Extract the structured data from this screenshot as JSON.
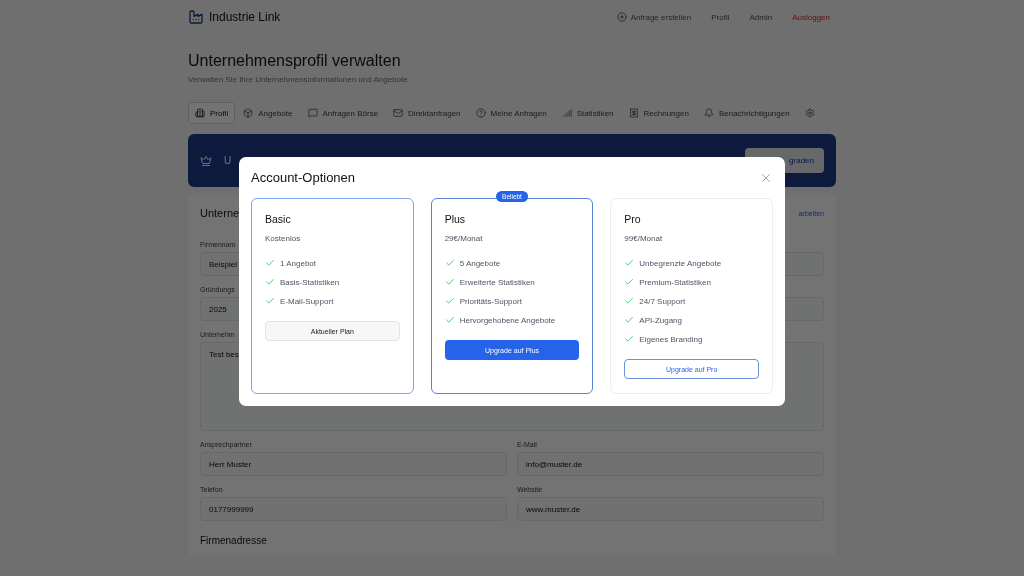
{
  "header": {
    "brand": "Industrie Link",
    "nav": [
      {
        "label": "Anfrage erstellen",
        "kind": "action"
      },
      {
        "label": "Profil",
        "kind": "plain"
      },
      {
        "label": "Admin",
        "kind": "plain"
      },
      {
        "label": "Ausloggen",
        "kind": "danger"
      }
    ]
  },
  "page": {
    "title": "Unternehmensprofil verwalten",
    "subtitle": "Verwalten Sie Ihre Unternehmensinformationen und Angebote"
  },
  "tabs": [
    {
      "label": "Profil",
      "selected": true
    },
    {
      "label": "Angebote",
      "selected": false
    },
    {
      "label": "Anfragen Börse",
      "selected": false
    },
    {
      "label": "Direktanfragen",
      "selected": false
    },
    {
      "label": "Meine Anfragen",
      "selected": false
    },
    {
      "label": "Statistiken",
      "selected": false
    },
    {
      "label": "Rechnungen",
      "selected": false
    },
    {
      "label": "Benachrichtigungen",
      "selected": false
    }
  ],
  "banner": {
    "text": "U",
    "button": "graden"
  },
  "form": {
    "heading": "Unterne",
    "edit_link": "arbeiten",
    "top_fields": [
      {
        "label": "Firmennam",
        "value": "Beispiel",
        "kind": "input"
      },
      {
        "label": "Gründungs",
        "value": "2025",
        "kind": "input"
      },
      {
        "label": "Unternehm",
        "value": "Test bes",
        "kind": "textarea"
      }
    ],
    "fields": [
      {
        "label": "Ansprechpartner",
        "value": "Herr Muster"
      },
      {
        "label": "E-Mail",
        "value": "info@muster.de"
      },
      {
        "label": "Telefon",
        "value": "0177999999"
      },
      {
        "label": "Website",
        "value": "www.muster.de"
      }
    ],
    "section": "Firmenadresse"
  },
  "modal": {
    "title": "Account-Optionen",
    "plans": [
      {
        "name": "Basic",
        "price": "Kostenlos",
        "selected": true,
        "features": [
          "1 Angebot",
          "Basis-Statistiken",
          "E-Mail-Support"
        ],
        "button": {
          "label": "Aktueller Plan",
          "kind": "current"
        }
      },
      {
        "name": "Plus",
        "price": "29€/Monat",
        "selected": false,
        "badge": "Beliebt",
        "features": [
          "5 Angebote",
          "Erweiterte Statistiken",
          "Prioritäts-Support",
          "Hervorgehobene Angebote"
        ],
        "button": {
          "label": "Upgrade auf Plus",
          "kind": "primary"
        }
      },
      {
        "name": "Pro",
        "price": "99€/Monat",
        "selected": false,
        "features": [
          "Unbegrenzte Angebote",
          "Premium-Statistiken",
          "24/7 Support",
          "API-Zugang",
          "Eigenes Branding"
        ],
        "button": {
          "label": "Upgrade auf Pro",
          "kind": "outline"
        }
      }
    ]
  }
}
